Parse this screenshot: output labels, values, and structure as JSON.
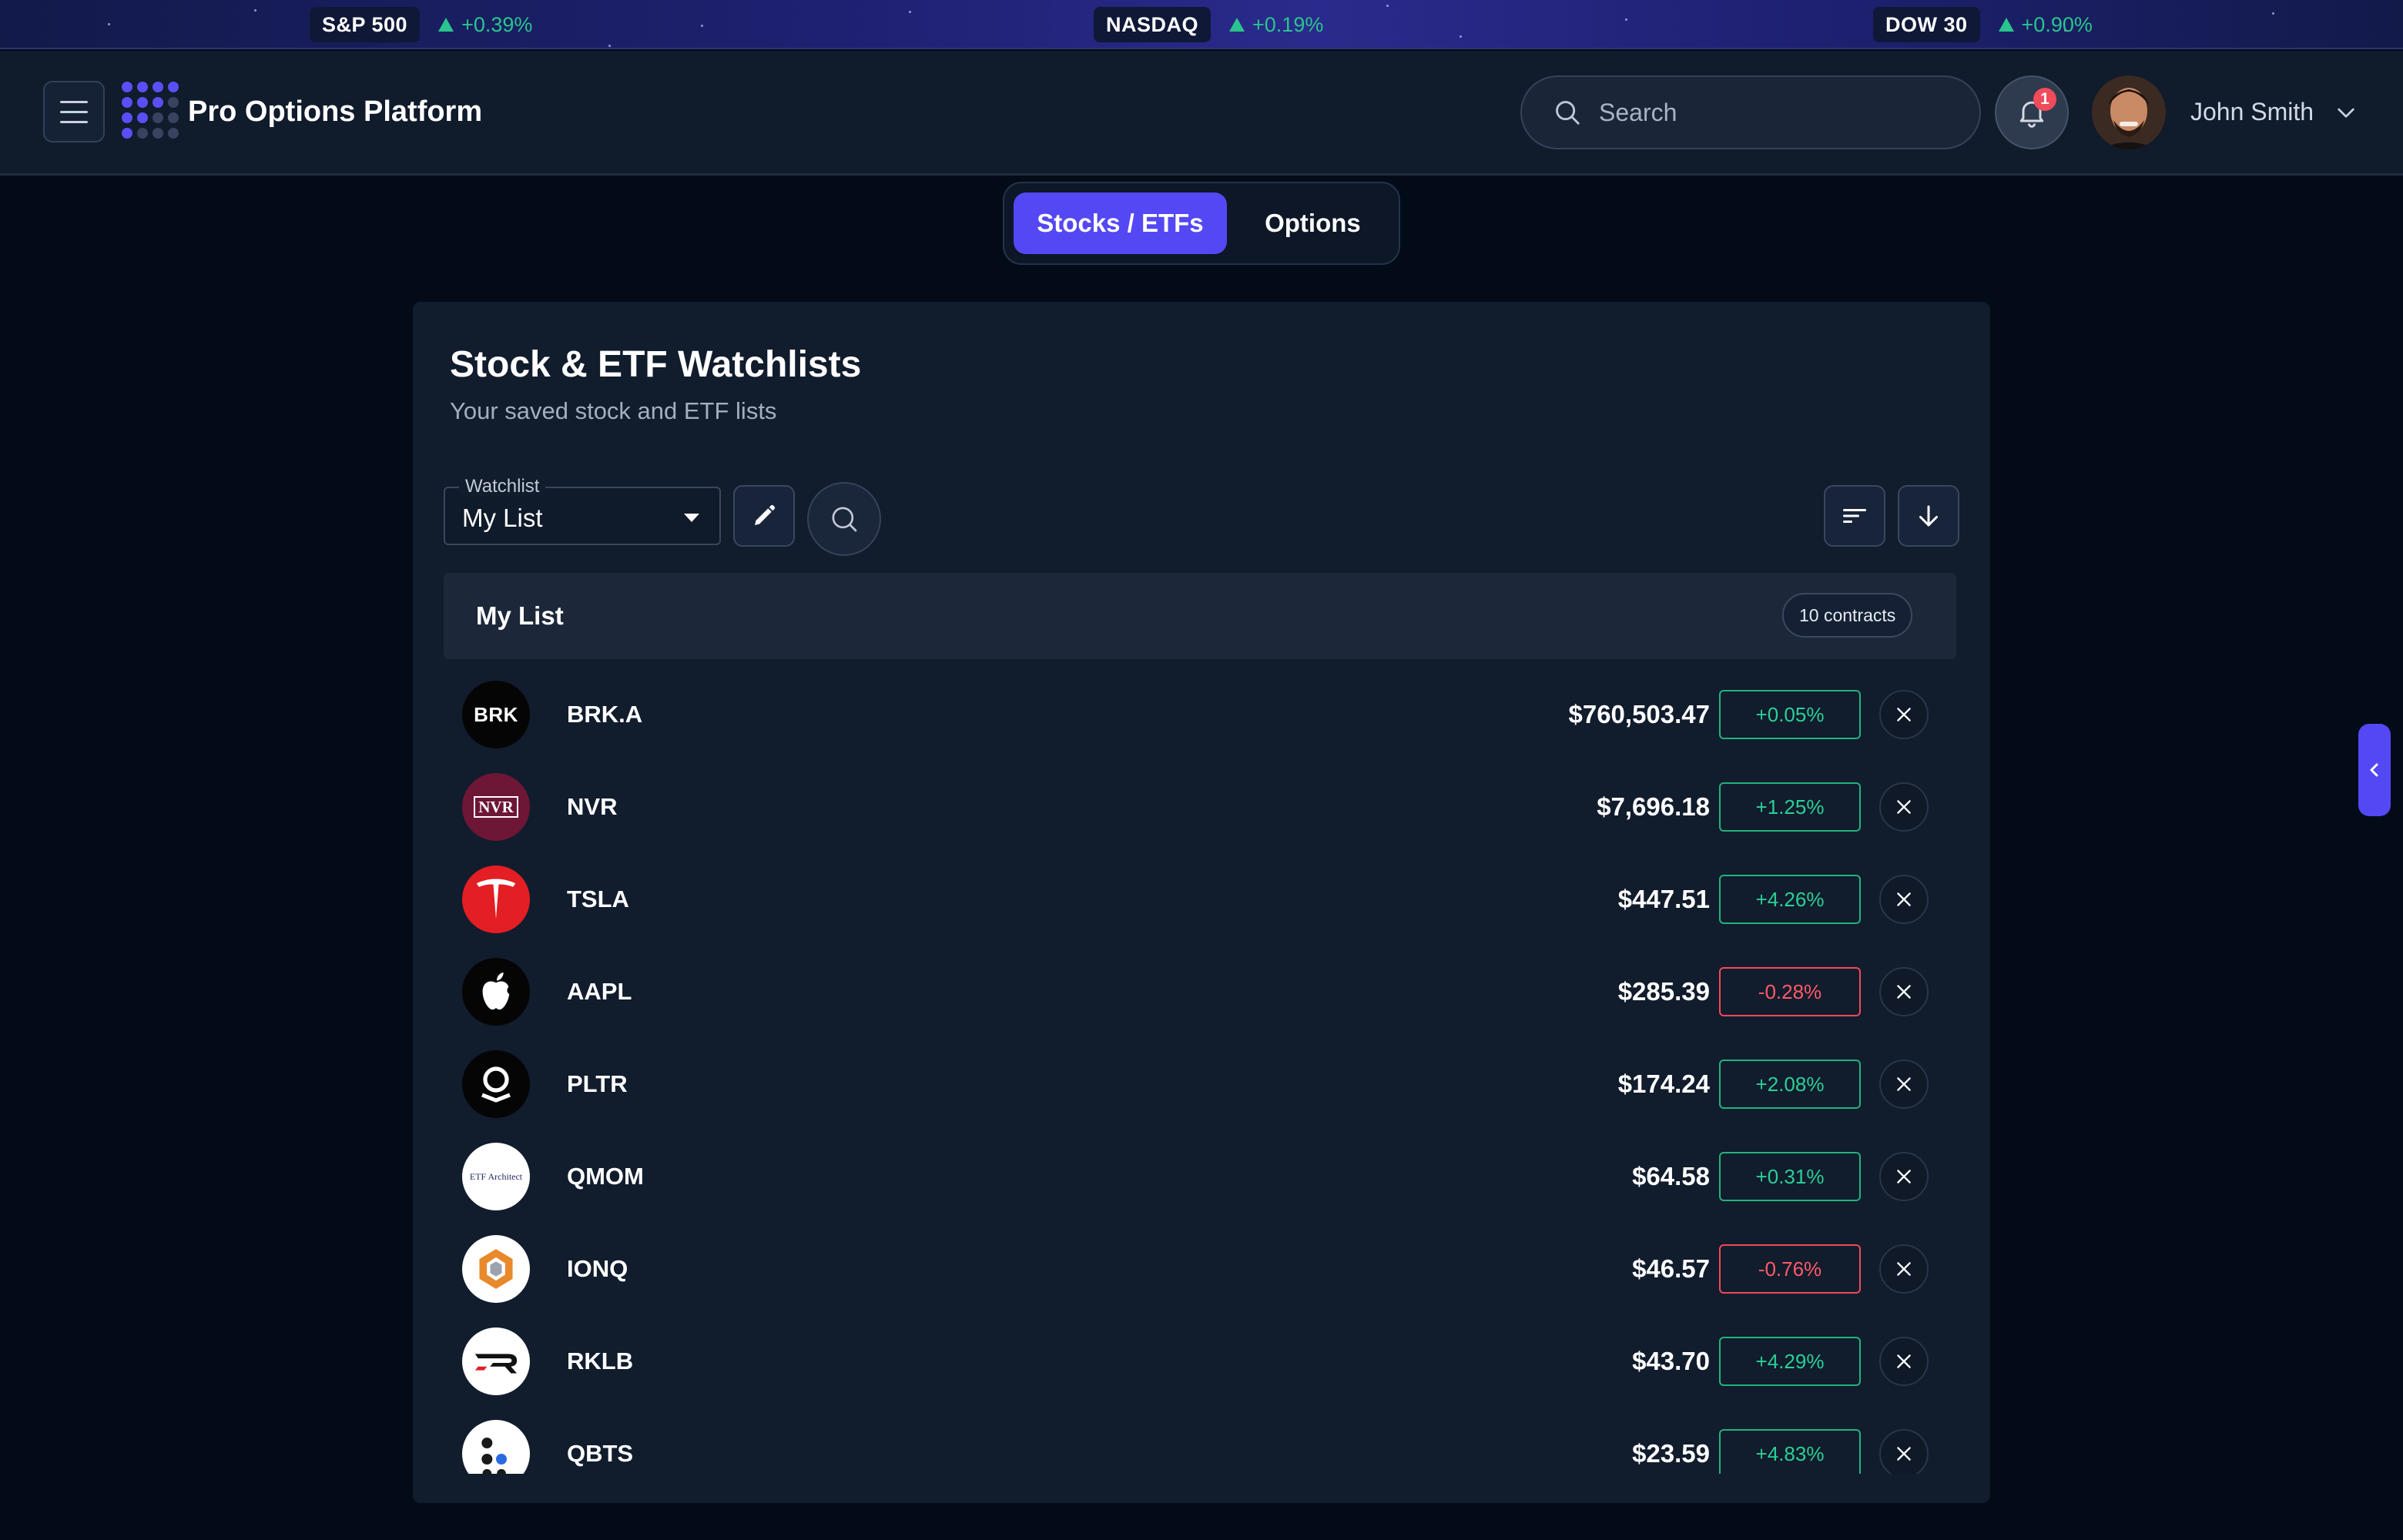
{
  "ticker": [
    {
      "name": "S&P 500",
      "change": "+0.39%"
    },
    {
      "name": "NASDAQ",
      "change": "+0.19%"
    },
    {
      "name": "DOW 30",
      "change": "+0.90%"
    }
  ],
  "header": {
    "app_title": "Pro Options Platform",
    "search_placeholder": "Search",
    "notification_count": "1",
    "user_name": "John Smith"
  },
  "tabs": {
    "stocks_label": "Stocks / ETFs",
    "options_label": "Options",
    "active": "stocks"
  },
  "panel": {
    "title": "Stock & ETF Watchlists",
    "subtitle": "Your saved stock and ETF lists",
    "watchlist_label": "Watchlist",
    "watchlist_value": "My List",
    "list_name": "My List",
    "count": "10 contracts"
  },
  "rows": [
    {
      "symbol": "BRK.A",
      "price": "$760,503.47",
      "change": "+0.05%",
      "dir": "pos",
      "logo": "brk-logo",
      "logo_text": "BRK"
    },
    {
      "symbol": "NVR",
      "price": "$7,696.18",
      "change": "+1.25%",
      "dir": "pos",
      "logo": "nvr-logo",
      "logo_text": "NVR"
    },
    {
      "symbol": "TSLA",
      "price": "$447.51",
      "change": "+4.26%",
      "dir": "pos",
      "logo": "tesla-logo",
      "logo_text": ""
    },
    {
      "symbol": "AAPL",
      "price": "$285.39",
      "change": "-0.28%",
      "dir": "neg",
      "logo": "apple-logo",
      "logo_text": ""
    },
    {
      "symbol": "PLTR",
      "price": "$174.24",
      "change": "+2.08%",
      "dir": "pos",
      "logo": "palantir-logo",
      "logo_text": ""
    },
    {
      "symbol": "QMOM",
      "price": "$64.58",
      "change": "+0.31%",
      "dir": "pos",
      "logo": "etf-architect-logo",
      "logo_text": "ETF Architect"
    },
    {
      "symbol": "IONQ",
      "price": "$46.57",
      "change": "-0.76%",
      "dir": "neg",
      "logo": "ionq-logo",
      "logo_text": ""
    },
    {
      "symbol": "RKLB",
      "price": "$43.70",
      "change": "+4.29%",
      "dir": "pos",
      "logo": "rocket-lab-logo",
      "logo_text": ""
    },
    {
      "symbol": "QBTS",
      "price": "$23.59",
      "change": "+4.83%",
      "dir": "pos",
      "logo": "dwave-logo",
      "logo_text": ""
    }
  ],
  "colors": {
    "accent": "#5448f4",
    "positive": "#2bd095",
    "negative": "#ff5a66",
    "background": "#020b17",
    "panel": "#111c2d"
  }
}
